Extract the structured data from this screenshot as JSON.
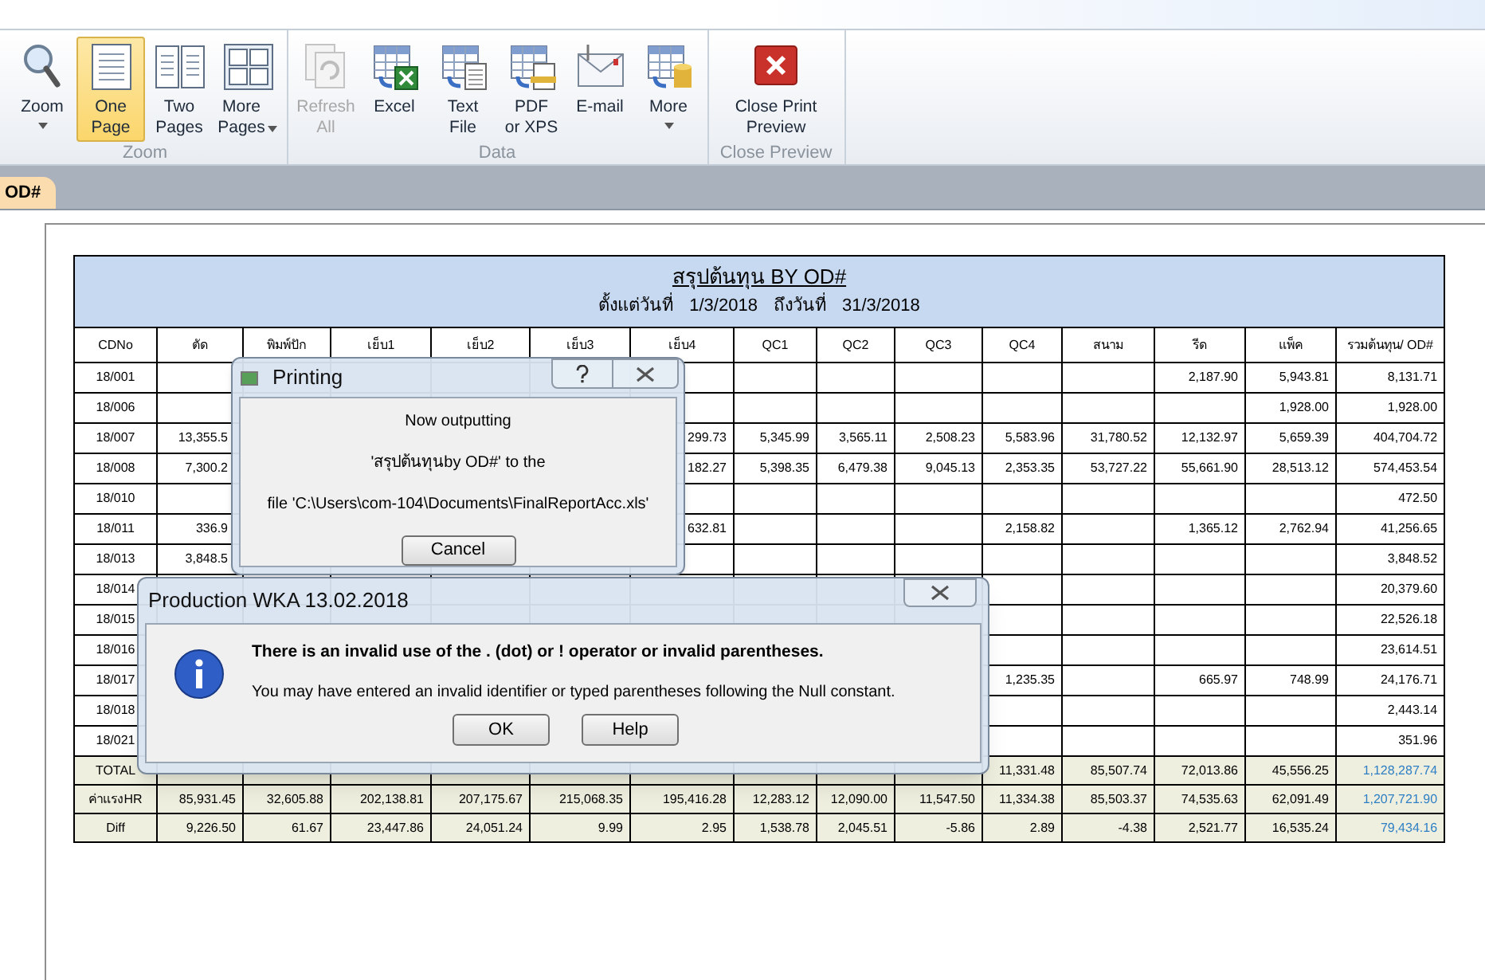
{
  "ribbon": {
    "groups": [
      {
        "label": "Zoom",
        "buttons": [
          {
            "label": "Zoom",
            "selected": false,
            "disabled": false,
            "dropdown": true
          },
          {
            "label": "One\nPage",
            "selected": true,
            "disabled": false,
            "dropdown": false
          },
          {
            "label": "Two\nPages",
            "selected": false,
            "disabled": false,
            "dropdown": false
          },
          {
            "label": "More\nPages",
            "selected": false,
            "disabled": false,
            "dropdown": true
          }
        ]
      },
      {
        "label": "Data",
        "buttons": [
          {
            "label": "Refresh\nAll",
            "selected": false,
            "disabled": true,
            "dropdown": false
          },
          {
            "label": "Excel",
            "selected": false,
            "disabled": false,
            "dropdown": false
          },
          {
            "label": "Text\nFile",
            "selected": false,
            "disabled": false,
            "dropdown": false
          },
          {
            "label": "PDF\nor XPS",
            "selected": false,
            "disabled": false,
            "dropdown": false
          },
          {
            "label": "E-mail",
            "selected": false,
            "disabled": false,
            "dropdown": false
          },
          {
            "label": "More",
            "selected": false,
            "disabled": false,
            "dropdown": true
          }
        ]
      },
      {
        "label": "Close Preview",
        "buttons": [
          {
            "label": "Close Print\nPreview",
            "selected": false,
            "disabled": false,
            "dropdown": false
          }
        ]
      }
    ]
  },
  "tabs": [
    {
      "label": "OD#",
      "selected": true
    }
  ],
  "report": {
    "title": "สรุปต้นทุน BY OD#",
    "date_from_label": "ตั้งแต่วันที่",
    "date_from": "1/3/2018",
    "date_to_label": "ถึงวันที่",
    "date_to": "31/3/2018",
    "columns": [
      "CDNo",
      "ตัด",
      "พิมพ์ปัก",
      "เย็บ1",
      "เย็บ2",
      "เย็บ3",
      "เย็บ4",
      "QC1",
      "QC2",
      "QC3",
      "QC4",
      "สนาม",
      "รีด",
      "แพ็ค",
      "รวมต้นทุน/ OD#"
    ],
    "rows": [
      {
        "kind": "data",
        "cells": [
          "18/001",
          null,
          null,
          null,
          null,
          null,
          null,
          null,
          null,
          null,
          null,
          null,
          "2,187.90",
          "5,943.81",
          "8,131.71"
        ]
      },
      {
        "kind": "data",
        "cells": [
          "18/006",
          null,
          null,
          null,
          null,
          null,
          null,
          null,
          null,
          null,
          null,
          null,
          null,
          "1,928.00",
          "1,928.00"
        ]
      },
      {
        "kind": "data",
        "cells": [
          "18/007",
          "13,355.5",
          null,
          null,
          null,
          null,
          "299.73",
          "5,345.99",
          "3,565.11",
          "2,508.23",
          "5,583.96",
          "31,780.52",
          "12,132.97",
          "5,659.39",
          "404,704.72"
        ]
      },
      {
        "kind": "data",
        "cells": [
          "18/008",
          "7,300.2",
          null,
          null,
          null,
          null,
          "182.27",
          "5,398.35",
          "6,479.38",
          "9,045.13",
          "2,353.35",
          "53,727.22",
          "55,661.90",
          "28,513.12",
          "574,453.54"
        ]
      },
      {
        "kind": "data",
        "cells": [
          "18/010",
          null,
          null,
          null,
          null,
          null,
          null,
          null,
          null,
          null,
          null,
          null,
          null,
          null,
          "472.50"
        ]
      },
      {
        "kind": "data",
        "cells": [
          "18/011",
          "336.9",
          null,
          null,
          null,
          null,
          "632.81",
          null,
          null,
          null,
          "2,158.82",
          null,
          "1,365.12",
          "2,762.94",
          "41,256.65"
        ]
      },
      {
        "kind": "data",
        "cells": [
          "18/013",
          "3,848.5",
          null,
          null,
          null,
          null,
          null,
          null,
          null,
          null,
          null,
          null,
          null,
          null,
          "3,848.52"
        ]
      },
      {
        "kind": "data",
        "cells": [
          "18/014",
          null,
          null,
          null,
          null,
          null,
          null,
          null,
          null,
          null,
          null,
          null,
          null,
          null,
          "20,379.60"
        ]
      },
      {
        "kind": "data",
        "cells": [
          "18/015",
          null,
          null,
          null,
          null,
          null,
          null,
          null,
          null,
          null,
          null,
          null,
          null,
          null,
          "22,526.18"
        ]
      },
      {
        "kind": "data",
        "cells": [
          "18/016",
          null,
          null,
          null,
          null,
          null,
          null,
          null,
          null,
          null,
          null,
          null,
          null,
          null,
          "23,614.51"
        ]
      },
      {
        "kind": "data",
        "cells": [
          "18/017",
          null,
          null,
          null,
          null,
          null,
          null,
          null,
          null,
          null,
          "1,235.35",
          null,
          "665.97",
          "748.99",
          "24,176.71"
        ]
      },
      {
        "kind": "data",
        "cells": [
          "18/018",
          null,
          null,
          null,
          null,
          null,
          null,
          null,
          null,
          null,
          null,
          null,
          null,
          null,
          "2,443.14"
        ]
      },
      {
        "kind": "data",
        "cells": [
          "18/021",
          null,
          null,
          null,
          null,
          null,
          null,
          null,
          null,
          null,
          null,
          null,
          null,
          null,
          "351.96"
        ]
      },
      {
        "kind": "summary",
        "cells": [
          "TOTAL",
          null,
          null,
          null,
          null,
          null,
          null,
          null,
          null,
          null,
          "11,331.48",
          "85,507.74",
          "72,013.86",
          "45,556.25",
          "1,128,287.74"
        ]
      },
      {
        "kind": "summary",
        "cells": [
          "ค่าแรงHR",
          "85,931.45",
          "32,605.88",
          "202,138.81",
          "207,175.67",
          "215,068.35",
          "195,416.28",
          "12,283.12",
          "12,090.00",
          "11,547.50",
          "11,334.38",
          "85,503.37",
          "74,535.63",
          "62,091.49",
          "1,207,721.90"
        ]
      },
      {
        "kind": "summary",
        "cells": [
          "Diff",
          "9,226.50",
          "61.67",
          "23,447.86",
          "24,051.24",
          "9.99",
          "2.95",
          "1,538.78",
          "2,045.51",
          "-5.86",
          "2.89",
          "-4.38",
          "2,521.77",
          "16,535.24",
          "79,434.16"
        ]
      }
    ]
  },
  "printing_dialog": {
    "title": "Printing",
    "lines": [
      "Now outputting",
      "'สรุปต้นทุนby OD#' to the",
      "file 'C:\\Users\\com-104\\Documents\\FinalReportAcc.xls'"
    ],
    "buttons": [
      "Cancel"
    ]
  },
  "error_dialog": {
    "title": "Production WKA 13.02.2018",
    "message": "There is an invalid use of the . (dot) or ! operator or invalid parentheses.",
    "detail": "You may have entered an invalid identifier or typed parentheses following the Null constant.",
    "buttons": [
      "OK",
      "Help"
    ]
  }
}
